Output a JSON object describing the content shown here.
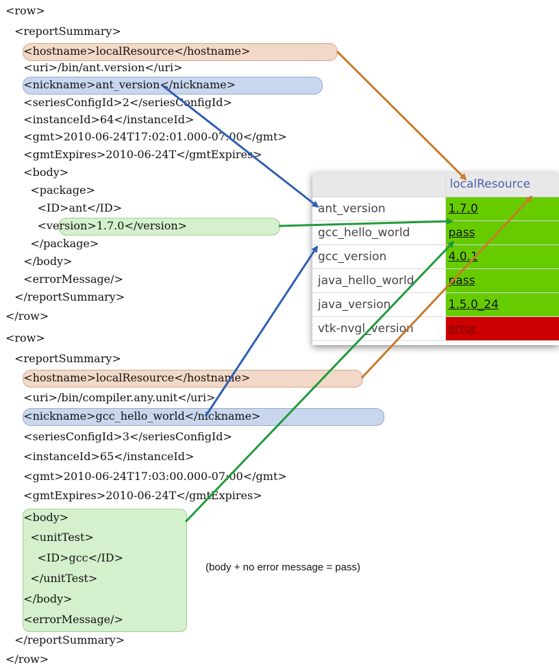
{
  "xml_lines": [
    "<row>",
    " <reportSummary>",
    "  <hostname>localResource</hostname>",
    "  <uri>/bin/ant.version</uri>",
    "  <nickname>ant_version</nickname>",
    "  <seriesConfigId>2</seriesConfigId>",
    "  <instanceId>64</instanceId>",
    "  <gmt>2010-06-24T17:02:01.000-07:00</gmt>",
    "  <gmtExpires>2010-06-24T</gmtExpires>",
    "  <body>",
    "    <package>",
    "      <ID>ant</ID>",
    "      <version>1.7.0</version>",
    "    </package>",
    "  </body>",
    "  <errorMessage/>",
    " </reportSummary>",
    "</row>",
    "<row>",
    " <reportSummary>",
    "  <hostname>localResource</hostname>",
    "  <uri>/bin/compiler.any.unit</uri>",
    "  <nickname>gcc_hello_world</nickname>",
    "  <seriesConfigId>3</seriesConfigId>",
    "  <instanceId>65</instanceId>",
    "  <gmt>2010-06-24T17:03:00.000-07:00</gmt>",
    "  <gmtExpires>2010-06-24T</gmtExpires>",
    "  <body>",
    "    <unitTest>",
    "      <ID>gcc</ID>",
    "    </unitTest>",
    "  </body>",
    "  <errorMessage/>",
    " </reportSummary>",
    "</row>"
  ],
  "note": "(body + no error message = pass)",
  "report_table": {
    "column_header": "localResource",
    "rows": [
      {
        "name": "ant_version",
        "value": "1.7.0",
        "status": "pass"
      },
      {
        "name": "gcc_hello_world",
        "value": "pass",
        "status": "pass"
      },
      {
        "name": "gcc_version",
        "value": "4.0.1",
        "status": "pass"
      },
      {
        "name": "java_hello_world",
        "value": "pass",
        "status": "pass"
      },
      {
        "name": "java_version",
        "value": "1.5.0_24",
        "status": "pass"
      },
      {
        "name": "vtk-nvgl_version",
        "value": "error",
        "status": "error"
      }
    ]
  },
  "colors": {
    "hostname_highlight": "#f2d8c6",
    "nickname_highlight": "#c9d7ee",
    "value_highlight": "#d4f0cc",
    "arrow_hostname": "#c87a2a",
    "arrow_nickname": "#2f5fb3",
    "arrow_value": "#1f9a3a",
    "pass": "#66cc00",
    "error": "#cc0000",
    "header_link": "#4a5fa8"
  }
}
